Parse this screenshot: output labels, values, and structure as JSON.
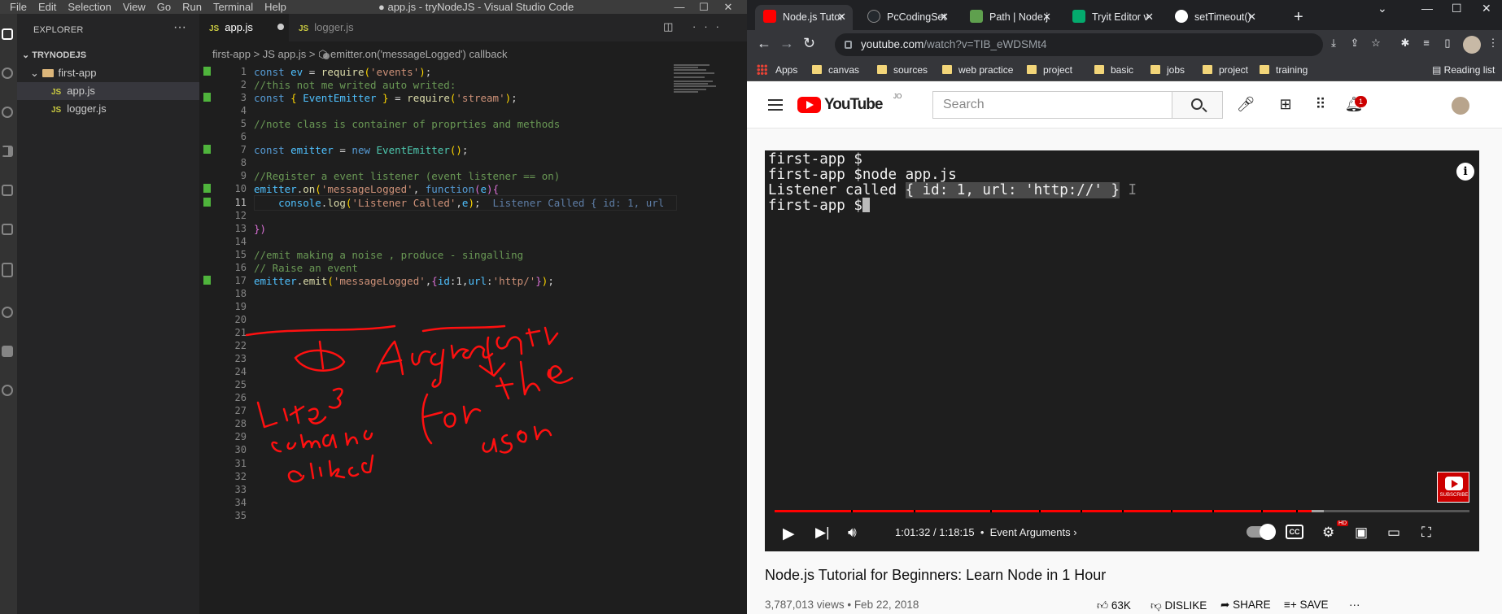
{
  "vscode": {
    "menu": [
      "File",
      "Edit",
      "Selection",
      "View",
      "Go",
      "Run",
      "Terminal",
      "Help"
    ],
    "window_title": "● app.js - tryNodeJS - Visual Studio Code",
    "explorer": {
      "header": "EXPLORER",
      "project": "TRYNODEJS",
      "folder": "first-app",
      "files": [
        "app.js",
        "logger.js"
      ]
    },
    "tabs": [
      {
        "label": "app.js"
      },
      {
        "label": "logger.js"
      }
    ],
    "breadcrumb": "first-app  >  JS  app.js  >  ⬡ emitter.on('messageLogged') callback",
    "gutter_numbers": [
      "1",
      "2",
      "3",
      "4",
      "5",
      "6",
      "7",
      "8",
      "9",
      "10",
      "11",
      "12",
      "13",
      "14",
      "15",
      "16",
      "17",
      "18",
      "19",
      "20",
      "21",
      "22",
      "23",
      "24",
      "25",
      "26",
      "27",
      "28",
      "29",
      "30",
      "31",
      "32",
      "33",
      "34",
      "35"
    ],
    "code": [
      {
        "parts": [
          {
            "c": "k",
            "t": "const "
          },
          {
            "c": "v",
            "t": "ev"
          },
          {
            "c": "",
            "t": " = "
          },
          {
            "c": "f",
            "t": "require"
          },
          {
            "c": "y",
            "t": "("
          },
          {
            "c": "s",
            "t": "'events'"
          },
          {
            "c": "y",
            "t": ")"
          },
          {
            "c": "",
            "t": ";"
          }
        ]
      },
      {
        "parts": [
          {
            "c": "c",
            "t": "//this not me writed auto writed:"
          }
        ]
      },
      {
        "parts": [
          {
            "c": "k",
            "t": "const "
          },
          {
            "c": "y",
            "t": "{ "
          },
          {
            "c": "v",
            "t": "EventEmitter"
          },
          {
            "c": "y",
            "t": " }"
          },
          {
            "c": "",
            "t": " = "
          },
          {
            "c": "f",
            "t": "require"
          },
          {
            "c": "y",
            "t": "("
          },
          {
            "c": "s",
            "t": "'stream'"
          },
          {
            "c": "y",
            "t": ")"
          },
          {
            "c": "",
            "t": ";"
          }
        ]
      },
      {
        "parts": []
      },
      {
        "parts": [
          {
            "c": "c",
            "t": "//note class is container of proprties and methods"
          }
        ]
      },
      {
        "parts": []
      },
      {
        "parts": [
          {
            "c": "k",
            "t": "const "
          },
          {
            "c": "v",
            "t": "emitter"
          },
          {
            "c": "",
            "t": " = "
          },
          {
            "c": "k",
            "t": "new "
          },
          {
            "c": "t",
            "t": "EventEmitter"
          },
          {
            "c": "y",
            "t": "()"
          },
          {
            "c": "",
            "t": ";"
          }
        ]
      },
      {
        "parts": []
      },
      {
        "parts": [
          {
            "c": "c",
            "t": "//Register a event listener (event listener == on)"
          }
        ]
      },
      {
        "parts": [
          {
            "c": "v",
            "t": "emitter"
          },
          {
            "c": "",
            "t": "."
          },
          {
            "c": "f",
            "t": "on"
          },
          {
            "c": "y",
            "t": "("
          },
          {
            "c": "s",
            "t": "'messageLogged'"
          },
          {
            "c": "",
            "t": ", "
          },
          {
            "c": "k",
            "t": "function"
          },
          {
            "c": "p",
            "t": "("
          },
          {
            "c": "v",
            "t": "e"
          },
          {
            "c": "p",
            "t": "){"
          }
        ]
      },
      {
        "parts": [
          {
            "c": "",
            "t": "    "
          },
          {
            "c": "v",
            "t": "console"
          },
          {
            "c": "",
            "t": "."
          },
          {
            "c": "f",
            "t": "log"
          },
          {
            "c": "y",
            "t": "("
          },
          {
            "c": "s",
            "t": "'Listener Called'"
          },
          {
            "c": "",
            "t": ","
          },
          {
            "c": "v",
            "t": "e"
          },
          {
            "c": "y",
            "t": ")"
          },
          {
            "c": "",
            "t": ";  "
          },
          {
            "c": "ghost",
            "t": "Listener Called { id: 1, url"
          }
        ]
      },
      {
        "parts": []
      },
      {
        "parts": [
          {
            "c": "p",
            "t": "})"
          }
        ]
      },
      {
        "parts": []
      },
      {
        "parts": [
          {
            "c": "c",
            "t": "//emit making a noise , produce - singalling"
          }
        ]
      },
      {
        "parts": [
          {
            "c": "c",
            "t": "// Raise an event"
          }
        ]
      },
      {
        "parts": [
          {
            "c": "v",
            "t": "emitter"
          },
          {
            "c": "",
            "t": "."
          },
          {
            "c": "f",
            "t": "emit"
          },
          {
            "c": "y",
            "t": "("
          },
          {
            "c": "s",
            "t": "'messageLogged'"
          },
          {
            "c": "",
            "t": ","
          },
          {
            "c": "p",
            "t": "{"
          },
          {
            "c": "v",
            "t": "id"
          },
          {
            "c": "",
            "t": ":1,"
          },
          {
            "c": "v",
            "t": "url"
          },
          {
            "c": "",
            "t": ":"
          },
          {
            "c": "s",
            "t": "'http/'"
          },
          {
            "c": "p",
            "t": "}"
          },
          {
            "c": "y",
            "t": ")"
          },
          {
            "c": "",
            "t": ";"
          }
        ]
      }
    ],
    "modified_lines": [
      1,
      3,
      7,
      10,
      11,
      17
    ],
    "annotations": [
      "Like someone clicked",
      "Argument for the user"
    ]
  },
  "chrome": {
    "tabs": [
      {
        "label": "Node.js Tutor",
        "fav": "#ff0000"
      },
      {
        "label": "PcCodingSet",
        "fav": "#24292e"
      },
      {
        "label": "Path | Node.j",
        "fav": "#5fa04e"
      },
      {
        "label": "Tryit Editor v",
        "fav": "#04aa6d"
      },
      {
        "label": "setTimeout()",
        "fav": "#ffffff"
      }
    ],
    "address": {
      "domain": "youtube.com",
      "path": "/watch?v=TIB_eWDSMt4"
    },
    "bookmarks": [
      "Apps",
      "canvas",
      "sources",
      "web practice",
      "project",
      "basic",
      "jobs",
      "project",
      "training"
    ],
    "reading_list": "Reading list"
  },
  "youtube": {
    "brand": "YouTube",
    "country": "JO",
    "search_placeholder": "Search",
    "notification_count": "1",
    "terminal": {
      "line1": "first-app $",
      "line2": "first-app $node app.js",
      "line3_a": "Listener called ",
      "line3_b": "{ id: 1, url: 'http://' }",
      "line4": "first-app $"
    },
    "subscribe_label": "SUBSCRIBE",
    "time": "1:01:32 / 1:18:15",
    "chapter": "Event Arguments",
    "progress_fraction": 0.773,
    "buffered_fraction": 0.79,
    "chapter_marks": [
      0.11,
      0.2,
      0.31,
      0.38,
      0.44,
      0.5,
      0.57,
      0.63,
      0.7,
      0.75
    ],
    "cc_label": "CC",
    "hd_label": "HD",
    "video_title": "Node.js Tutorial for Beginners: Learn Node in 1 Hour",
    "views": "3,787,013 views",
    "date": "Feb 22, 2018",
    "likes": "63K",
    "dislike": "DISLIKE",
    "share": "SHARE",
    "save": "SAVE"
  }
}
